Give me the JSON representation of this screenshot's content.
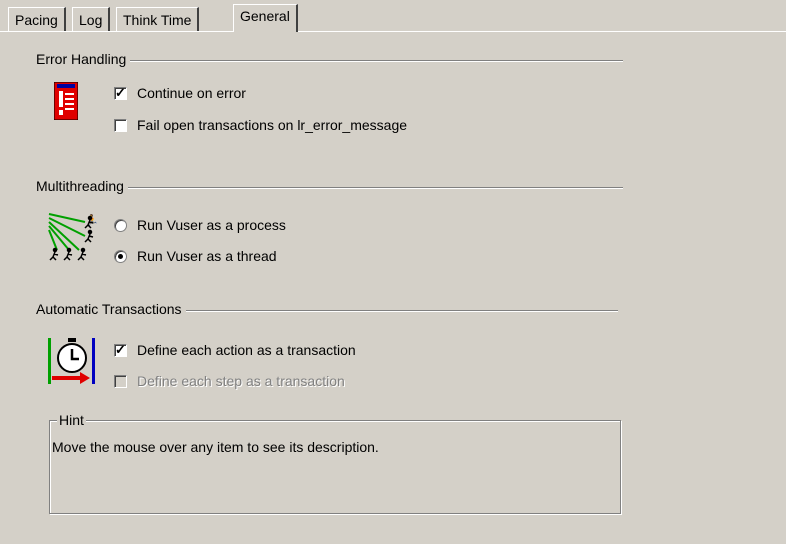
{
  "tabs": [
    {
      "label": "Pacing"
    },
    {
      "label": "Log"
    },
    {
      "label": "Think Time"
    },
    {
      "label": "General",
      "active": true
    }
  ],
  "error_handling": {
    "title": "Error Handling",
    "icon": "error-report-icon",
    "continue_on_error": {
      "label": "Continue on error",
      "checked": true
    },
    "fail_open_transactions": {
      "label": "Fail open transactions on lr_error_message",
      "checked": false
    }
  },
  "multithreading": {
    "title": "Multithreading",
    "icon": "vuser-threads-icon",
    "run_as_process": {
      "label": "Run Vuser as a process",
      "selected": false
    },
    "run_as_thread": {
      "label": "Run Vuser as a thread",
      "selected": true
    }
  },
  "automatic_transactions": {
    "title": "Automatic Transactions",
    "icon": "stopwatch-transaction-icon",
    "define_action": {
      "label": "Define each action as a transaction",
      "checked": true
    },
    "define_step": {
      "label": "Define each step as a transaction",
      "checked": false,
      "enabled": false
    }
  },
  "hint": {
    "title": "Hint",
    "text": "Move the mouse over any item to see its description."
  },
  "colors": {
    "dialog_bg": "#d4d0c8",
    "error_icon_red": "#e00000",
    "thread_icon_green": "#00a000",
    "stopwatch_blue": "#0000c0"
  }
}
